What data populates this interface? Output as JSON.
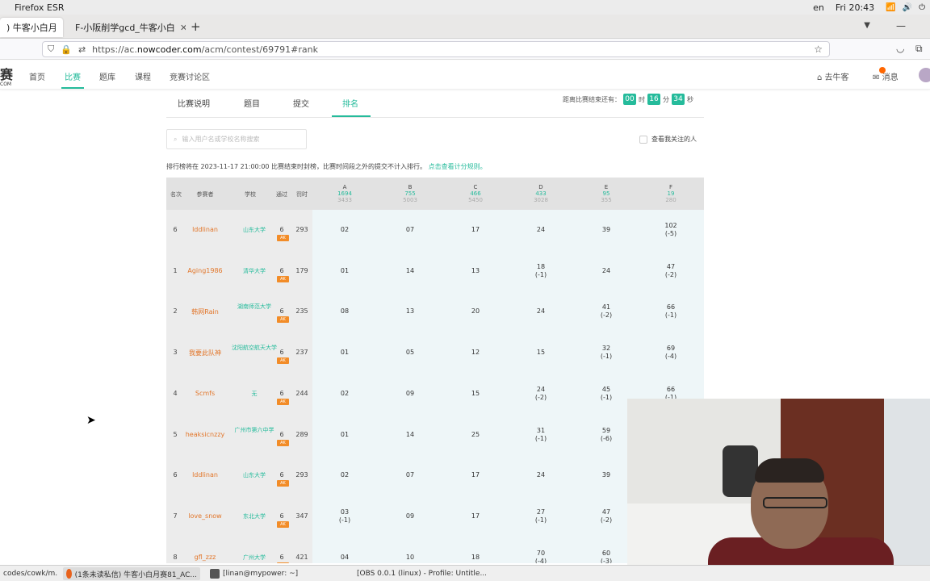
{
  "os": {
    "app": "Firefox ESR",
    "lang": "en",
    "clock": "Fri 20:43"
  },
  "browser": {
    "tabs": [
      {
        "label": ") 牛客小白月",
        "active": true
      },
      {
        "label": "F-小阪削学gcd_牛客小白",
        "active": false
      }
    ],
    "url_prefix": "https://ac.",
    "url_host": "nowcoder.com",
    "url_path": "/acm/contest/69791#rank"
  },
  "site": {
    "logo": "赛",
    "logo_sub": "COM",
    "nav": [
      "首页",
      "比赛",
      "题库",
      "课程",
      "竞赛讨论区"
    ],
    "active_nav": "比赛",
    "go_home": "去牛客",
    "messages": "消息"
  },
  "contest": {
    "tabs": [
      "比赛说明",
      "题目",
      "提交",
      "排名"
    ],
    "active_tab": "排名",
    "countdown_label": "距离比赛结束还有：",
    "hours": "00",
    "hours_unit": "时",
    "minutes": "16",
    "minutes_unit": "分",
    "seconds": "34",
    "seconds_unit": "秒",
    "search_placeholder": "输入用户名或学校名称搜索",
    "follow_label": "查看我关注的人",
    "note_prefix": "排行榜将在 2023-11-17 21:00:00 比赛结束时封榜，比赛时间段之外的提交不计入排行。",
    "note_link": "点击查看计分规则。"
  },
  "rank": {
    "headers": {
      "rank": "名次",
      "user": "参赛者",
      "school": "学校",
      "solved": "通过",
      "penalty": "罚时"
    },
    "problems": [
      {
        "label": "A",
        "ac": "1694",
        "total": "3433"
      },
      {
        "label": "B",
        "ac": "755",
        "total": "5003"
      },
      {
        "label": "C",
        "ac": "466",
        "total": "5450"
      },
      {
        "label": "D",
        "ac": "433",
        "total": "3028"
      },
      {
        "label": "E",
        "ac": "95",
        "total": "355"
      },
      {
        "label": "F",
        "ac": "19",
        "total": "280"
      }
    ],
    "ak_label": "AK",
    "rows": [
      {
        "rank": "6",
        "user": "lddlinan",
        "school": "山东大学",
        "solved": "6",
        "penalty": "293",
        "cells": [
          [
            "02",
            ""
          ],
          [
            "07",
            ""
          ],
          [
            "17",
            ""
          ],
          [
            "24",
            ""
          ],
          [
            "39",
            ""
          ],
          [
            "102",
            "(-5)"
          ]
        ]
      },
      {
        "rank": "1",
        "user": "Aging1986",
        "school": "清华大学",
        "solved": "6",
        "penalty": "179",
        "cells": [
          [
            "01",
            ""
          ],
          [
            "14",
            ""
          ],
          [
            "13",
            ""
          ],
          [
            "18",
            "(-1)"
          ],
          [
            "24",
            ""
          ],
          [
            "47",
            "(-2)"
          ]
        ]
      },
      {
        "rank": "2",
        "user": "韩网Rain",
        "school": "湖南师范大学",
        "solved": "6",
        "penalty": "235",
        "cells": [
          [
            "08",
            ""
          ],
          [
            "13",
            ""
          ],
          [
            "20",
            ""
          ],
          [
            "24",
            ""
          ],
          [
            "41",
            "(-2)"
          ],
          [
            "66",
            "(-1)"
          ]
        ]
      },
      {
        "rank": "3",
        "user": "我要此队神",
        "school": "沈阳航空航天大学",
        "solved": "6",
        "penalty": "237",
        "cells": [
          [
            "01",
            ""
          ],
          [
            "05",
            ""
          ],
          [
            "12",
            ""
          ],
          [
            "15",
            ""
          ],
          [
            "32",
            "(-1)"
          ],
          [
            "69",
            "(-4)"
          ]
        ]
      },
      {
        "rank": "4",
        "user": "Scmfs",
        "school": "无",
        "solved": "6",
        "penalty": "244",
        "cells": [
          [
            "02",
            ""
          ],
          [
            "09",
            ""
          ],
          [
            "15",
            ""
          ],
          [
            "24",
            "(-2)"
          ],
          [
            "45",
            "(-1)"
          ],
          [
            "66",
            "(-1)"
          ]
        ]
      },
      {
        "rank": "5",
        "user": "heaksicnzzy",
        "school": "广州市第六中学",
        "solved": "6",
        "penalty": "289",
        "cells": [
          [
            "01",
            ""
          ],
          [
            "14",
            ""
          ],
          [
            "25",
            ""
          ],
          [
            "31",
            "(-1)"
          ],
          [
            "59",
            "(-6)"
          ],
          [
            "",
            ""
          ]
        ]
      },
      {
        "rank": "6",
        "user": "lddlinan",
        "school": "山东大学",
        "solved": "6",
        "penalty": "293",
        "cells": [
          [
            "02",
            ""
          ],
          [
            "07",
            ""
          ],
          [
            "17",
            ""
          ],
          [
            "24",
            ""
          ],
          [
            "39",
            ""
          ],
          [
            "",
            ""
          ]
        ]
      },
      {
        "rank": "7",
        "user": "love_snow",
        "school": "东北大学",
        "solved": "6",
        "penalty": "347",
        "cells": [
          [
            "03",
            "(-1)"
          ],
          [
            "09",
            ""
          ],
          [
            "17",
            ""
          ],
          [
            "27",
            "(-1)"
          ],
          [
            "47",
            "(-2)"
          ],
          [
            "",
            ""
          ]
        ]
      },
      {
        "rank": "8",
        "user": "gfl_zzz",
        "school": "广州大学",
        "solved": "6",
        "penalty": "421",
        "cells": [
          [
            "04",
            ""
          ],
          [
            "10",
            ""
          ],
          [
            "18",
            ""
          ],
          [
            "70",
            "(-4)"
          ],
          [
            "60",
            "(-3)"
          ],
          [
            "",
            ""
          ]
        ]
      }
    ]
  },
  "taskbar": [
    {
      "label": "codes/cowk/m..."
    },
    {
      "label": "(1条未读私信) 牛客小白月赛81_AC..."
    },
    {
      "label": "[linan@mypower: ~]"
    },
    {
      "label": "[OBS 0.0.1 (linux) - Profile: Untitle..."
    }
  ]
}
